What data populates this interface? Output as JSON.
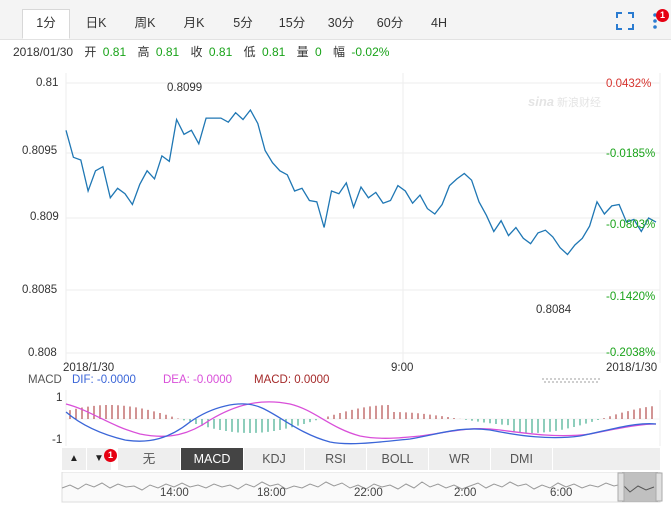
{
  "tabs": [
    "1分",
    "日K",
    "周K",
    "月K",
    "5分",
    "15分",
    "30分",
    "60分",
    "4H"
  ],
  "active_tab": 0,
  "toolbar": {
    "fullscreen_icon": "fullscreen-icon",
    "more_icon": "more-vertical-icon",
    "notify_badge": "1"
  },
  "info": {
    "date": "2018/01/30",
    "open_label": "开",
    "open": "0.81",
    "high_label": "高",
    "high": "0.81",
    "close_label": "收",
    "close": "0.81",
    "low_label": "低",
    "low": "0.81",
    "volume_label": "量",
    "volume": "0",
    "change_label": "幅",
    "change": "-0.02%"
  },
  "watermark": "新浪财经",
  "price_chart": {
    "y_ticks": [
      "0.81",
      "0.8095",
      "0.809",
      "0.8085",
      "0.808"
    ],
    "pct_ticks": [
      "0.0432%",
      "-0.0185%",
      "-0.0803%",
      "-0.1420%",
      "-0.2038%"
    ],
    "high_label": "0.8099",
    "low_label": "0.8084",
    "x_labels": [
      "2018/1/30",
      "9:00",
      "2018/1/30"
    ]
  },
  "macd": {
    "label": "MACD",
    "dif": "DIF: -0.0000",
    "dea": "DEA: -0.0000",
    "macd": "MACD: 0.0000",
    "y_top": "1",
    "y_bottom": "-1"
  },
  "indicator_tabs": [
    "无",
    "MACD",
    "KDJ",
    "RSI",
    "BOLL",
    "WR",
    "DMI"
  ],
  "active_indicator": 1,
  "indicator_badge": "1",
  "navigator": {
    "time_labels": [
      "14:00",
      "18:00",
      "22:00",
      "2:00",
      "6:00"
    ]
  },
  "colors": {
    "line": "#1f77b4",
    "dif": "#3b66d8",
    "dea": "#d94fd9",
    "macd_up": "#a52a2a",
    "macd_down": "#1c9e78",
    "green": "#19a319",
    "red": "#d6342f"
  },
  "chart_data": {
    "type": "line",
    "x_labels": [
      "2018/1/30",
      "9:00",
      "2018/1/30"
    ],
    "ylim": [
      0.808,
      0.81
    ],
    "series": [
      {
        "values": [
          0.80965,
          0.80945,
          0.80943,
          0.8092,
          0.80935,
          0.80938,
          0.80915,
          0.80922,
          0.80918,
          0.8091,
          0.80925,
          0.80935,
          0.80929,
          0.80946,
          0.80942,
          0.80973,
          0.80962,
          0.80965,
          0.80955,
          0.80974,
          0.80974,
          0.80974,
          0.80971,
          0.80978,
          0.80973,
          0.8098,
          0.8097,
          0.8095,
          0.80941,
          0.80935,
          0.80932,
          0.8092,
          0.80922,
          0.80913,
          0.80912,
          0.80893,
          0.8092,
          0.80918,
          0.80926,
          0.80908,
          0.80923,
          0.80915,
          0.80919,
          0.80911,
          0.80913,
          0.80924,
          0.8092,
          0.80911,
          0.80917,
          0.80907,
          0.80903,
          0.8091,
          0.80924,
          0.80929,
          0.80933,
          0.80928,
          0.80912,
          0.80902,
          0.8089,
          0.80898,
          0.80887,
          0.80893,
          0.80885,
          0.80881,
          0.80889,
          0.80891,
          0.80886,
          0.80878,
          0.80873,
          0.8088,
          0.80885,
          0.80894,
          0.80912,
          0.80903,
          0.80909,
          0.8091,
          0.80897,
          0.80899,
          0.8089,
          0.809,
          0.80897
        ]
      }
    ]
  }
}
